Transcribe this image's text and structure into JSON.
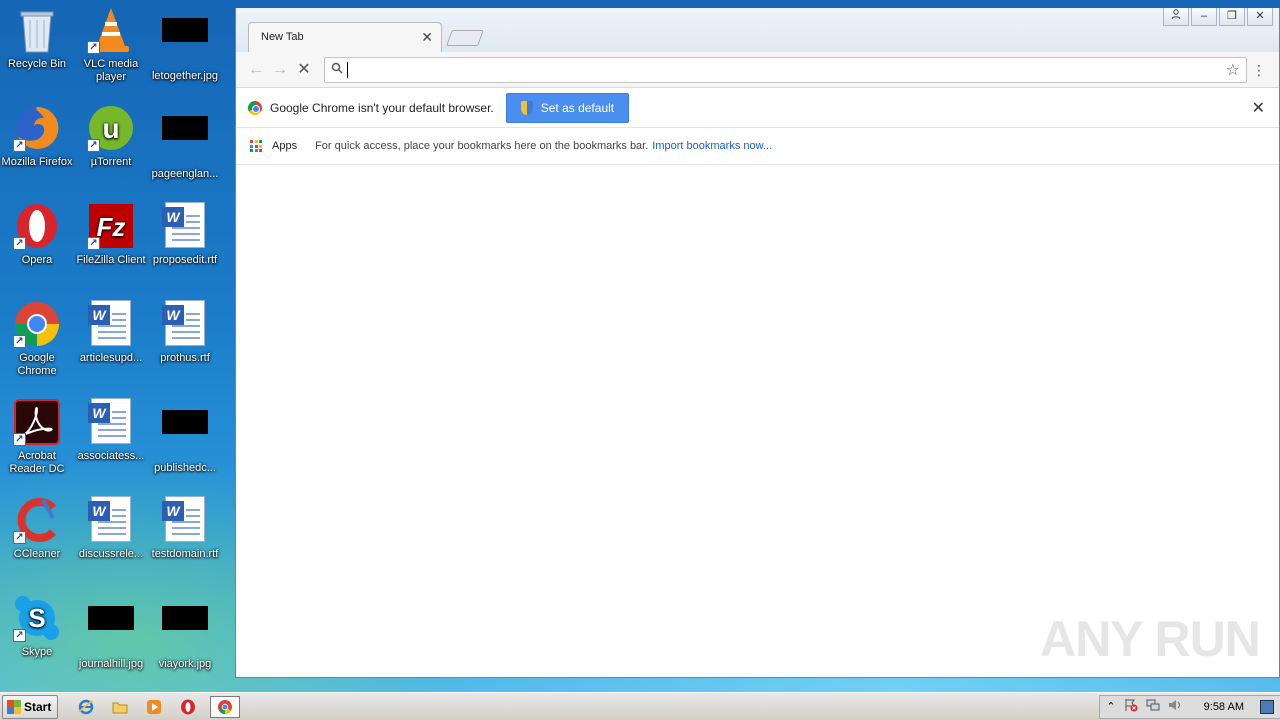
{
  "desktop": {
    "icons": [
      {
        "label": "Recycle Bin",
        "icon": "recycle-bin-icon"
      },
      {
        "label": "VLC media player",
        "icon": "vlc-icon"
      },
      {
        "label": "letogether.jpg",
        "icon": "image-file-icon"
      },
      {
        "label": "Mozilla Firefox",
        "icon": "firefox-icon"
      },
      {
        "label": "µTorrent",
        "icon": "utorrent-icon"
      },
      {
        "label": "pageenglan...",
        "icon": "image-file-icon"
      },
      {
        "label": "Opera",
        "icon": "opera-icon"
      },
      {
        "label": "FileZilla Client",
        "icon": "filezilla-icon"
      },
      {
        "label": "proposedit.rtf",
        "icon": "word-doc-icon"
      },
      {
        "label": "Google Chrome",
        "icon": "chrome-icon"
      },
      {
        "label": "articlesupd...",
        "icon": "word-doc-icon"
      },
      {
        "label": "prothus.rtf",
        "icon": "word-doc-icon"
      },
      {
        "label": "Acrobat Reader DC",
        "icon": "acrobat-icon"
      },
      {
        "label": "associatess...",
        "icon": "word-doc-icon"
      },
      {
        "label": "publishedc...",
        "icon": "image-file-icon"
      },
      {
        "label": "CCleaner",
        "icon": "ccleaner-icon"
      },
      {
        "label": "discussrele...",
        "icon": "word-doc-icon"
      },
      {
        "label": "testdomain.rtf",
        "icon": "word-doc-icon"
      },
      {
        "label": "Skype",
        "icon": "skype-icon"
      },
      {
        "label": "journalhill.jpg",
        "icon": "image-file-icon"
      },
      {
        "label": "viayork.jpg",
        "icon": "image-file-icon"
      }
    ]
  },
  "browser": {
    "tab_title": "New Tab",
    "omnibox_value": "",
    "infobar": {
      "message": "Google Chrome isn't your default browser.",
      "button_label": "Set as default"
    },
    "bookmarks": {
      "apps_label": "Apps",
      "hint": "For quick access, place your bookmarks here on the bookmarks bar.",
      "import_link": "Import bookmarks now..."
    }
  },
  "watermark": "ANY RUN",
  "taskbar": {
    "start_label": "Start",
    "clock": "9:58 AM"
  },
  "colors": {
    "accent_button": "#4a8ff0",
    "link": "#1a5dc8"
  }
}
